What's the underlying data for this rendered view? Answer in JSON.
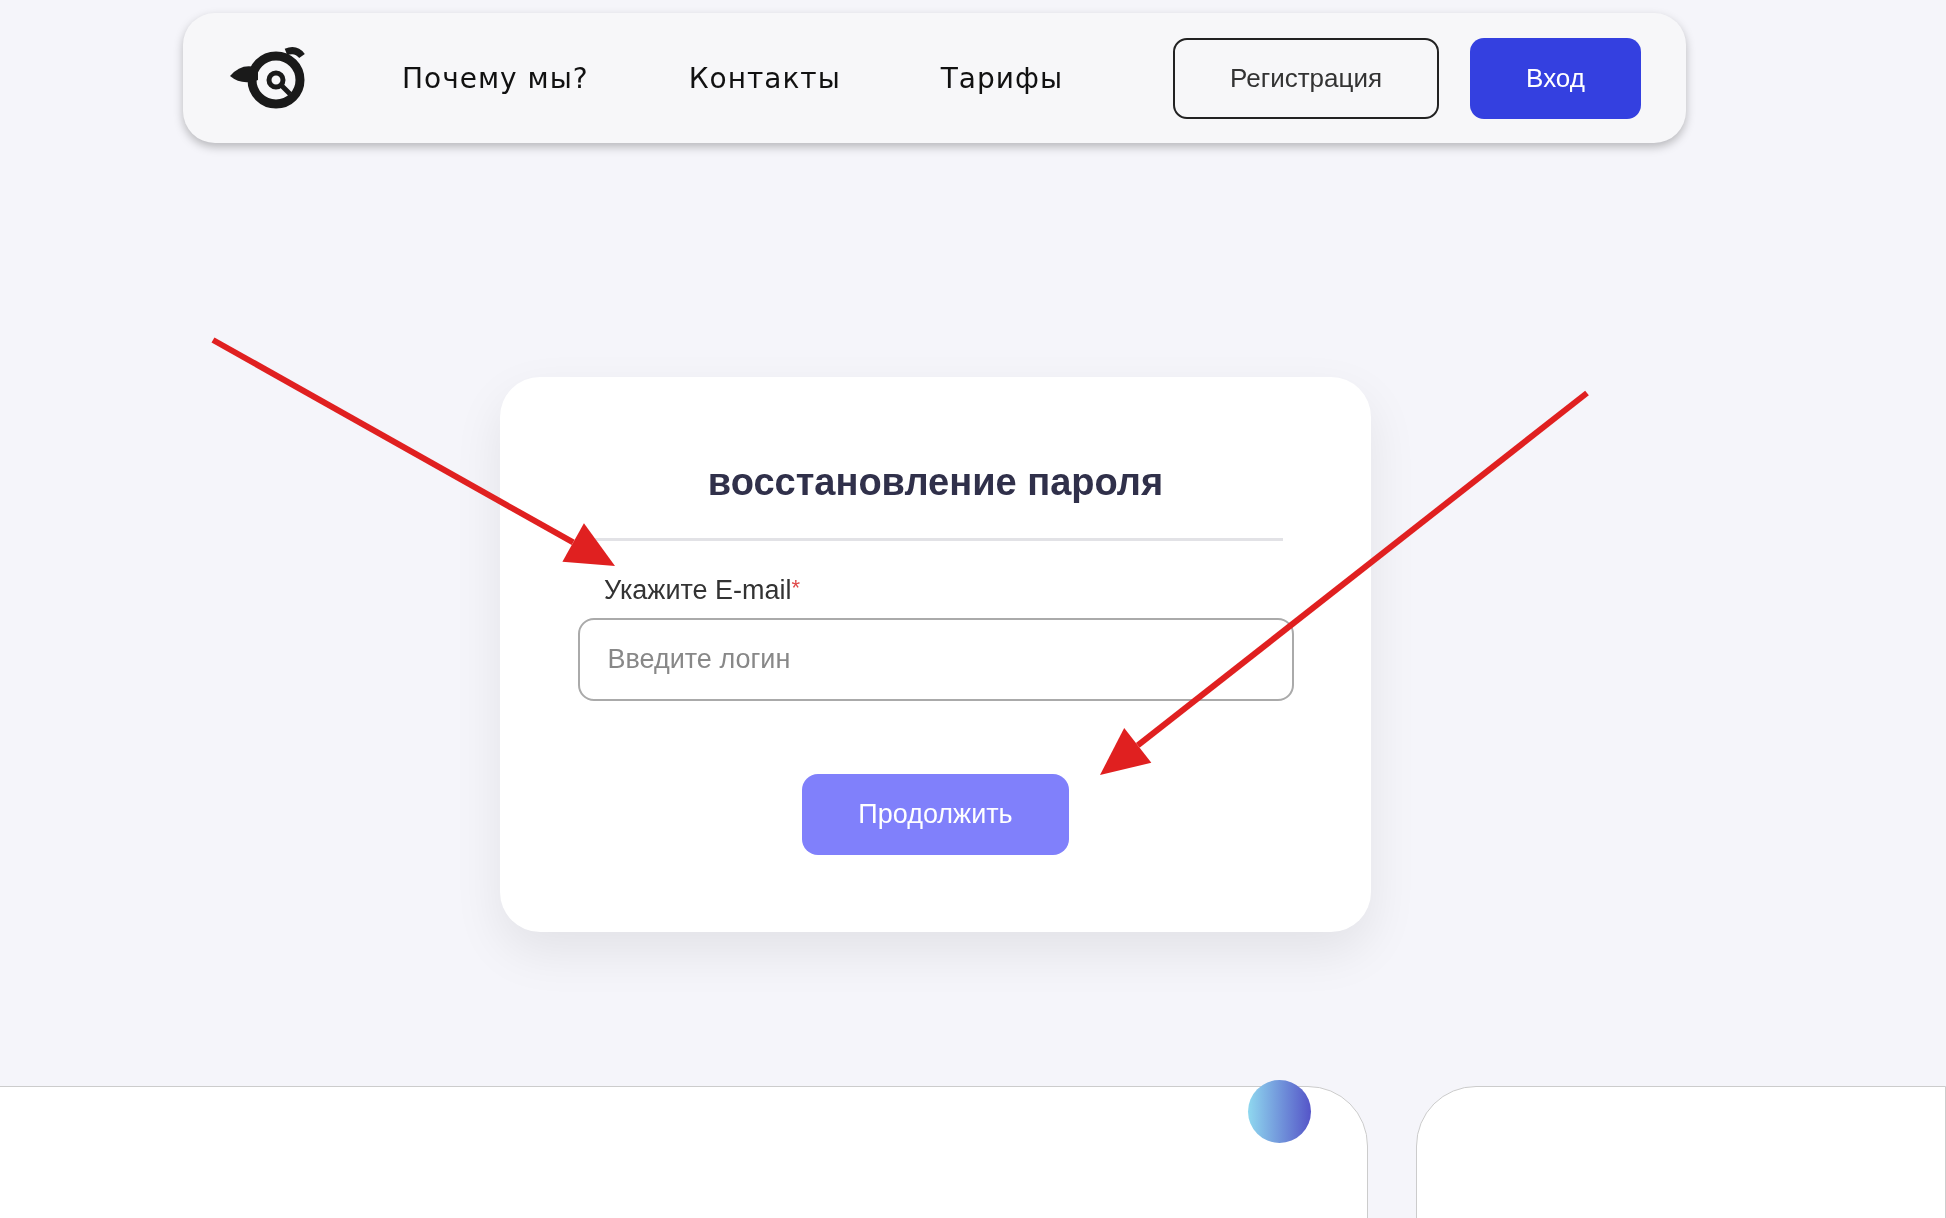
{
  "header": {
    "nav": [
      {
        "label": "Почему мы?"
      },
      {
        "label": "Контакты"
      },
      {
        "label": "Тарифы"
      }
    ],
    "buttons": [
      {
        "label": "Регистрация",
        "kind": "outline"
      },
      {
        "label": "Вход",
        "kind": "primary"
      }
    ]
  },
  "form": {
    "title": "восстановление пароля",
    "field": {
      "label": "Укажите E-mail",
      "required": true,
      "required_mark": "*",
      "placeholder": "Введите логин"
    },
    "submit": "Продолжить"
  }
}
